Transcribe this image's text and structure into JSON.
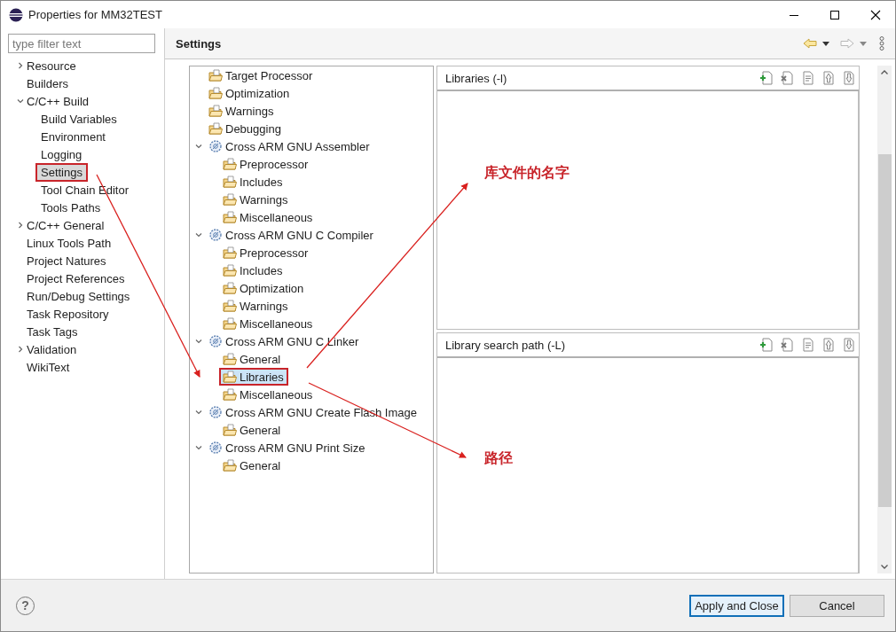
{
  "window": {
    "title": "Properties for MM32TEST"
  },
  "filter": {
    "placeholder": "type filter text"
  },
  "sidebar": {
    "items": [
      {
        "label": "Resource",
        "kind": "group",
        "expanded": false,
        "selected": false
      },
      {
        "label": "Builders",
        "selected": false
      },
      {
        "label": "C/C++ Build",
        "kind": "group",
        "expanded": true,
        "selected": false,
        "children": [
          {
            "label": "Build Variables",
            "selected": false
          },
          {
            "label": "Environment",
            "selected": false
          },
          {
            "label": "Logging",
            "selected": false
          },
          {
            "label": "Settings",
            "selected": true
          },
          {
            "label": "Tool Chain Editor",
            "selected": false
          },
          {
            "label": "Tools Paths",
            "selected": false
          }
        ]
      },
      {
        "label": "C/C++ General",
        "kind": "group",
        "expanded": false,
        "selected": false
      },
      {
        "label": "Linux Tools Path",
        "selected": false
      },
      {
        "label": "Project Natures",
        "selected": false
      },
      {
        "label": "Project References",
        "selected": false
      },
      {
        "label": "Run/Debug Settings",
        "selected": false
      },
      {
        "label": "Task Repository",
        "selected": false
      },
      {
        "label": "Task Tags",
        "selected": false
      },
      {
        "label": "Validation",
        "kind": "group",
        "expanded": false,
        "selected": false
      },
      {
        "label": "WikiText",
        "selected": false
      }
    ]
  },
  "page": {
    "title": "Settings",
    "nav": [
      {
        "kind": "back",
        "disabled": false
      },
      {
        "kind": "forward",
        "disabled": true
      }
    ]
  },
  "settings_tree": [
    {
      "label": "Target Processor",
      "kind": "option",
      "selected": false
    },
    {
      "label": "Optimization",
      "kind": "option",
      "selected": false
    },
    {
      "label": "Warnings",
      "kind": "option",
      "selected": false
    },
    {
      "label": "Debugging",
      "kind": "option",
      "selected": false
    },
    {
      "label": "Cross ARM GNU Assembler",
      "kind": "tool",
      "expanded": true,
      "selected": false,
      "children": [
        {
          "label": "Preprocessor",
          "kind": "option",
          "selected": false
        },
        {
          "label": "Includes",
          "kind": "option",
          "selected": false
        },
        {
          "label": "Warnings",
          "kind": "option",
          "selected": false
        },
        {
          "label": "Miscellaneous",
          "kind": "option",
          "selected": false
        }
      ]
    },
    {
      "label": "Cross ARM GNU C Compiler",
      "kind": "tool",
      "expanded": true,
      "selected": false,
      "children": [
        {
          "label": "Preprocessor",
          "kind": "option",
          "selected": false
        },
        {
          "label": "Includes",
          "kind": "option",
          "selected": false
        },
        {
          "label": "Optimization",
          "kind": "option",
          "selected": false
        },
        {
          "label": "Warnings",
          "kind": "option",
          "selected": false
        },
        {
          "label": "Miscellaneous",
          "kind": "option",
          "selected": false
        }
      ]
    },
    {
      "label": "Cross ARM GNU C Linker",
      "kind": "tool",
      "expanded": true,
      "selected": false,
      "children": [
        {
          "label": "General",
          "kind": "option",
          "selected": false
        },
        {
          "label": "Libraries",
          "kind": "option",
          "selected": true
        },
        {
          "label": "Miscellaneous",
          "kind": "option",
          "selected": false
        }
      ]
    },
    {
      "label": "Cross ARM GNU Create Flash Image",
      "kind": "tool",
      "expanded": true,
      "selected": false,
      "children": [
        {
          "label": "General",
          "kind": "option",
          "selected": false
        }
      ]
    },
    {
      "label": "Cross ARM GNU Print Size",
      "kind": "tool",
      "expanded": true,
      "selected": false,
      "children": [
        {
          "label": "General",
          "kind": "option",
          "selected": false
        }
      ]
    }
  ],
  "lists": [
    {
      "title": "Libraries (-l)"
    },
    {
      "title": "Library search path (-L)"
    }
  ],
  "annotations": [
    {
      "text": "库文件的名字"
    },
    {
      "text": "路径"
    }
  ],
  "help": {
    "glyph": "?"
  },
  "buttons": [
    {
      "label": "Apply and Close",
      "default": true
    },
    {
      "label": "Cancel",
      "default": false
    }
  ]
}
